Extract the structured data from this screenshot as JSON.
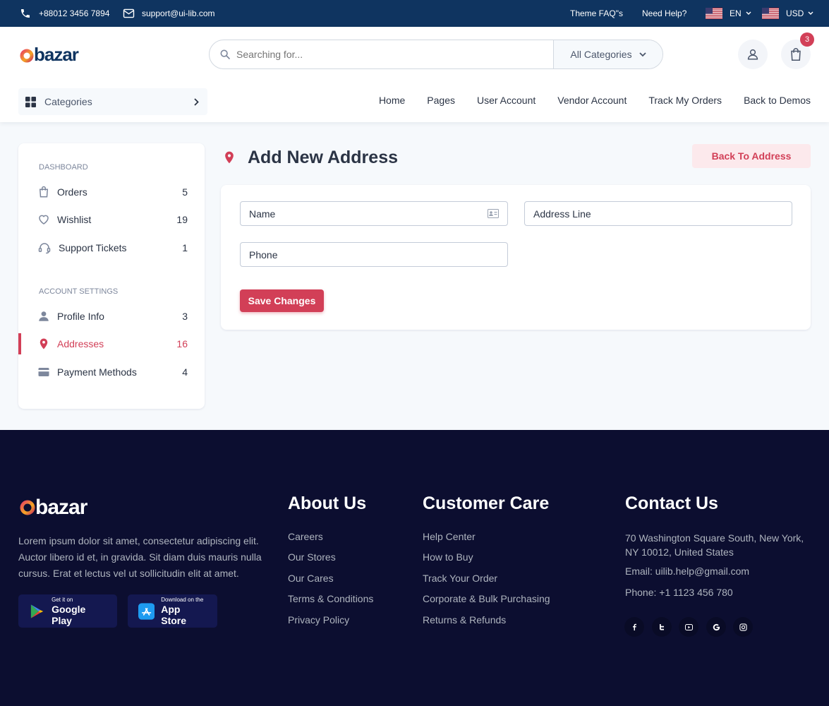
{
  "topbar": {
    "phone": "+88012 3456 7894",
    "email": "support@ui-lib.com",
    "faq": "Theme FAQ\"s",
    "help": "Need Help?",
    "language": "EN",
    "currency": "USD"
  },
  "header": {
    "logo": "bazar",
    "search_placeholder": "Searching for...",
    "category_select": "All Categories",
    "cart_count": "3",
    "categories_button": "Categories",
    "nav": [
      "Home",
      "Pages",
      "User Account",
      "Vendor Account",
      "Track My Orders",
      "Back to Demos"
    ]
  },
  "sidebar": {
    "dashboard_title": "DASHBOARD",
    "dashboard_items": [
      {
        "label": "Orders",
        "count": "5",
        "icon": "bag-icon"
      },
      {
        "label": "Wishlist",
        "count": "19",
        "icon": "heart-icon"
      },
      {
        "label": "Support Tickets",
        "count": "1",
        "icon": "headset-icon"
      }
    ],
    "account_title": "ACCOUNT SETTINGS",
    "account_items": [
      {
        "label": "Profile Info",
        "count": "3",
        "icon": "person-icon"
      },
      {
        "label": "Addresses",
        "count": "16",
        "icon": "location-pin-icon",
        "active": true
      },
      {
        "label": "Payment Methods",
        "count": "4",
        "icon": "credit-card-icon"
      }
    ]
  },
  "main": {
    "title": "Add New Address",
    "back_button": "Back To Address",
    "form": {
      "name_placeholder": "Name",
      "address_placeholder": "Address Line",
      "phone_placeholder": "Phone",
      "save_button": "Save Changes"
    }
  },
  "footer": {
    "logo": "bazar",
    "description": "Lorem ipsum dolor sit amet, consectetur adipiscing elit. Auctor libero id et, in gravida. Sit diam duis mauris nulla cursus. Erat et lectus vel ut sollicitudin elit at amet.",
    "google_play": {
      "small": "Get it on",
      "big": "Google Play"
    },
    "app_store": {
      "small": "Download on the",
      "big": "App Store"
    },
    "about": {
      "title": "About Us",
      "links": [
        "Careers",
        "Our Stores",
        "Our Cares",
        "Terms & Conditions",
        "Privacy Policy"
      ]
    },
    "care": {
      "title": "Customer Care",
      "links": [
        "Help Center",
        "How to Buy",
        "Track Your Order",
        "Corporate & Bulk Purchasing",
        "Returns & Refunds"
      ]
    },
    "contact": {
      "title": "Contact Us",
      "address": "70 Washington Square South, New York, NY 10012, United States",
      "email": "Email: uilib.help@gmail.com",
      "phone": "Phone: +1 1123 456 780"
    },
    "social": [
      "facebook-icon",
      "twitter-icon",
      "youtube-icon",
      "google-icon",
      "instagram-icon"
    ]
  },
  "colors": {
    "primary": "#d23f57",
    "topbar": "#0f3460",
    "footer": "#0c0e30",
    "text": "#2b3445"
  }
}
